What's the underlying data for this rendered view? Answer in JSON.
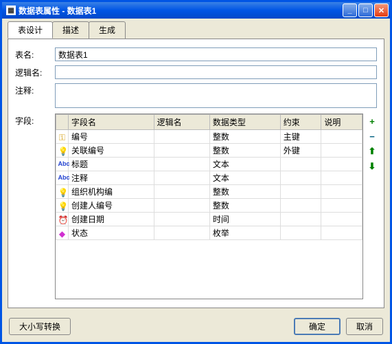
{
  "window": {
    "title": "数据表属性 - 数据表1"
  },
  "tabs": [
    {
      "label": "表设计",
      "active": true
    },
    {
      "label": "描述",
      "active": false
    },
    {
      "label": "生成",
      "active": false
    }
  ],
  "form": {
    "table_name_label": "表名:",
    "table_name_value": "数据表1",
    "logical_name_label": "逻辑名:",
    "logical_name_value": "",
    "comment_label": "注释:",
    "comment_value": ""
  },
  "fields_label": "字段:",
  "columns": {
    "field_name": "字段名",
    "logical_name": "逻辑名",
    "data_type": "数据类型",
    "constraint": "约束",
    "description": "说明"
  },
  "rows": [
    {
      "icon": "key",
      "field_name": "编号",
      "logical_name": "",
      "data_type": "整数",
      "constraint": "主键",
      "description": ""
    },
    {
      "icon": "bulb",
      "field_name": "关联编号",
      "logical_name": "",
      "data_type": "整数",
      "constraint": "外键",
      "description": ""
    },
    {
      "icon": "abc",
      "field_name": "标题",
      "logical_name": "",
      "data_type": "文本",
      "constraint": "",
      "description": ""
    },
    {
      "icon": "abc",
      "field_name": "注释",
      "logical_name": "",
      "data_type": "文本",
      "constraint": "",
      "description": ""
    },
    {
      "icon": "bulb",
      "field_name": "组织机构编",
      "logical_name": "",
      "data_type": "整数",
      "constraint": "",
      "description": ""
    },
    {
      "icon": "bulb",
      "field_name": "创建人编号",
      "logical_name": "",
      "data_type": "整数",
      "constraint": "",
      "description": ""
    },
    {
      "icon": "clock",
      "field_name": "创建日期",
      "logical_name": "",
      "data_type": "时间",
      "constraint": "",
      "description": ""
    },
    {
      "icon": "diamond",
      "field_name": "状态",
      "logical_name": "",
      "data_type": "枚举",
      "constraint": "",
      "description": ""
    }
  ],
  "side_buttons": {
    "add": "+",
    "remove": "−",
    "up": "⬆",
    "down": "⬇"
  },
  "footer": {
    "case_convert": "大小写转换",
    "ok": "确定",
    "cancel": "取消"
  }
}
